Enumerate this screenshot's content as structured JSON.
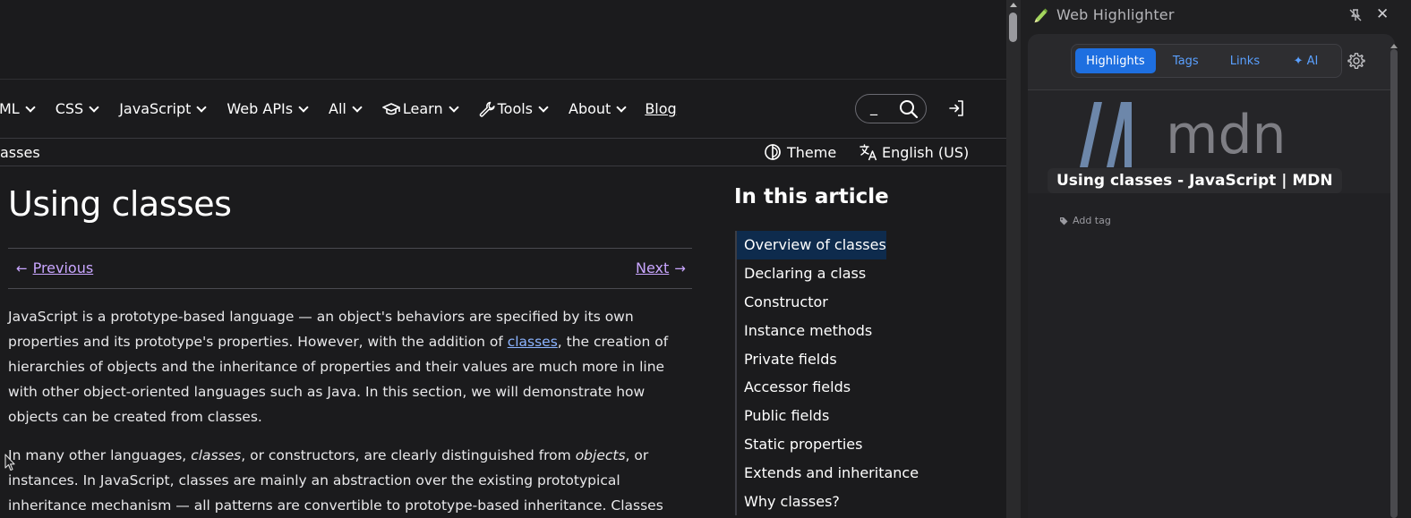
{
  "mdn": {
    "nav": {
      "items": [
        {
          "label": "ML",
          "icon": ""
        },
        {
          "label": "CSS",
          "icon": ""
        },
        {
          "label": "JavaScript",
          "icon": ""
        },
        {
          "label": "Web APIs",
          "icon": ""
        },
        {
          "label": "All",
          "icon": ""
        },
        {
          "label": "Learn",
          "icon": "graduation-cap-icon"
        },
        {
          "label": "Tools",
          "icon": "wrench-icon"
        },
        {
          "label": "About",
          "icon": ""
        }
      ],
      "blog_label": "Blog"
    },
    "search": {
      "cursor": "_"
    },
    "breadcrumb": "asses",
    "theme_label": "Theme",
    "language_label": "English (US)",
    "page_title": "Using classes",
    "prev_label": "Previous",
    "next_label": "Next",
    "p1": {
      "before": "JavaScript is a prototype-based language — an object's behaviors are specified by its own properties and its prototype's properties. However, with the addition of ",
      "link": "classes",
      "after": ", the creation of hierarchies of objects and the inheritance of properties and their values are much more in line with other object-oriented languages such as Java. In this section, we will demonstrate how objects can be created from classes."
    },
    "p2": {
      "t1": "In many other languages, ",
      "em1": "classes",
      "t2": ", or constructors, are clearly distinguished from ",
      "em2": "objects",
      "t3": ", or instances. In JavaScript, classes are mainly an abstraction over the existing prototypical inheritance mechanism — all patterns are convertible to prototype-based inheritance. Classes themselves are"
    },
    "toc": {
      "title": "In this article",
      "items": [
        "Overview of classes",
        "Declaring a class",
        "Constructor",
        "Instance methods",
        "Private fields",
        "Accessor fields",
        "Public fields",
        "Static properties",
        "Extends and inheritance",
        "Why classes?"
      ],
      "active_index": 0
    }
  },
  "highlighter": {
    "title": "Web Highlighter",
    "tabs": {
      "highlights": "Highlights",
      "tags": "Tags",
      "links": "Links",
      "ai": "✦ AI"
    },
    "logo_text": "mdn",
    "page_title": "Using classes - JavaScript | MDN",
    "add_tag_label": "Add tag",
    "colors": {
      "accent": "#1e6fe0",
      "tab_text": "#5aa0ff",
      "logo": "#6d87aa"
    }
  }
}
